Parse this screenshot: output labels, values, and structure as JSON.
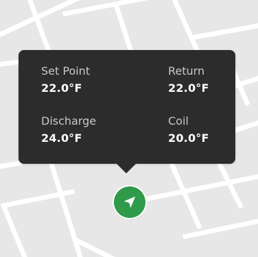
{
  "tooltip": {
    "set_point": {
      "label": "Set Point",
      "value": "22.0°F"
    },
    "return": {
      "label": "Return",
      "value": "22.0°F"
    },
    "discharge": {
      "label": "Discharge",
      "value": "24.0°F"
    },
    "coil": {
      "label": "Coil",
      "value": "20.0°F"
    }
  },
  "marker": {
    "icon": "navigation-arrow-icon",
    "color": "#2f9a4a"
  },
  "colors": {
    "map_background": "#e7e7e7",
    "road": "#ffffff",
    "tooltip_background": "#2c2c2c"
  }
}
